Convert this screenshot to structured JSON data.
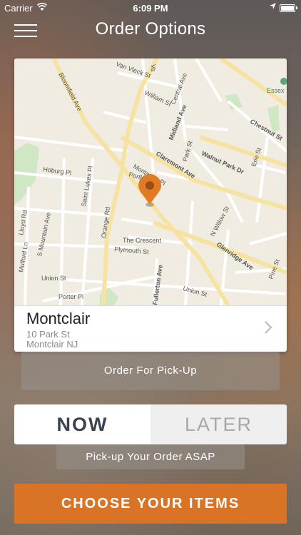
{
  "status_bar": {
    "carrier": "Carrier",
    "time": "6:09 PM"
  },
  "nav": {
    "title": "Order Options",
    "menu_icon": "hamburger-menu-icon"
  },
  "map": {
    "street_labels": {
      "bloomfield_ave": "Bloomfield Ave",
      "van_vleck": "Van Vleck St",
      "william": "William St",
      "central": "Central Ave",
      "midland": "Midland Ave",
      "chestnut": "Chestnut St",
      "essex": "Essex",
      "claremont": "Claremont Ave",
      "park": "Park St",
      "walnut_park": "Walnut Park Dr",
      "erie": "Erie St",
      "hoburg": "Hoburg Pl",
      "saint_lukes": "Saint Lukes Pl",
      "portland": "Portl",
      "montague": "Montague Pl",
      "lloyd": "Lloyd Rd",
      "s_mountain": "S Mountain Ave",
      "orange": "Orange Rd",
      "n_willow": "N Willow St",
      "mulford": "Mulford Ln",
      "the_crescent": "The Crescent",
      "plymouth": "Plymouth St",
      "glenridge": "Glenridge Ave",
      "fullerton": "Fullerton Ave",
      "union1": "Union St",
      "union2": "Union St",
      "porter": "Porter Pl",
      "pine": "Pine St"
    },
    "pin_color": "#e07a25"
  },
  "location": {
    "name": "Montclair",
    "address_line1": "10 Park St",
    "address_line2": "Montclair NJ"
  },
  "order_type_label": "Order For Pick-Up",
  "timing": {
    "now_label": "NOW",
    "later_label": "LATER",
    "selected": "NOW"
  },
  "timing_note": "Pick-up Your Order ASAP",
  "cta_label": "CHOOSE YOUR ITEMS",
  "colors": {
    "accent": "#d97427",
    "now_text": "#3a4350"
  }
}
